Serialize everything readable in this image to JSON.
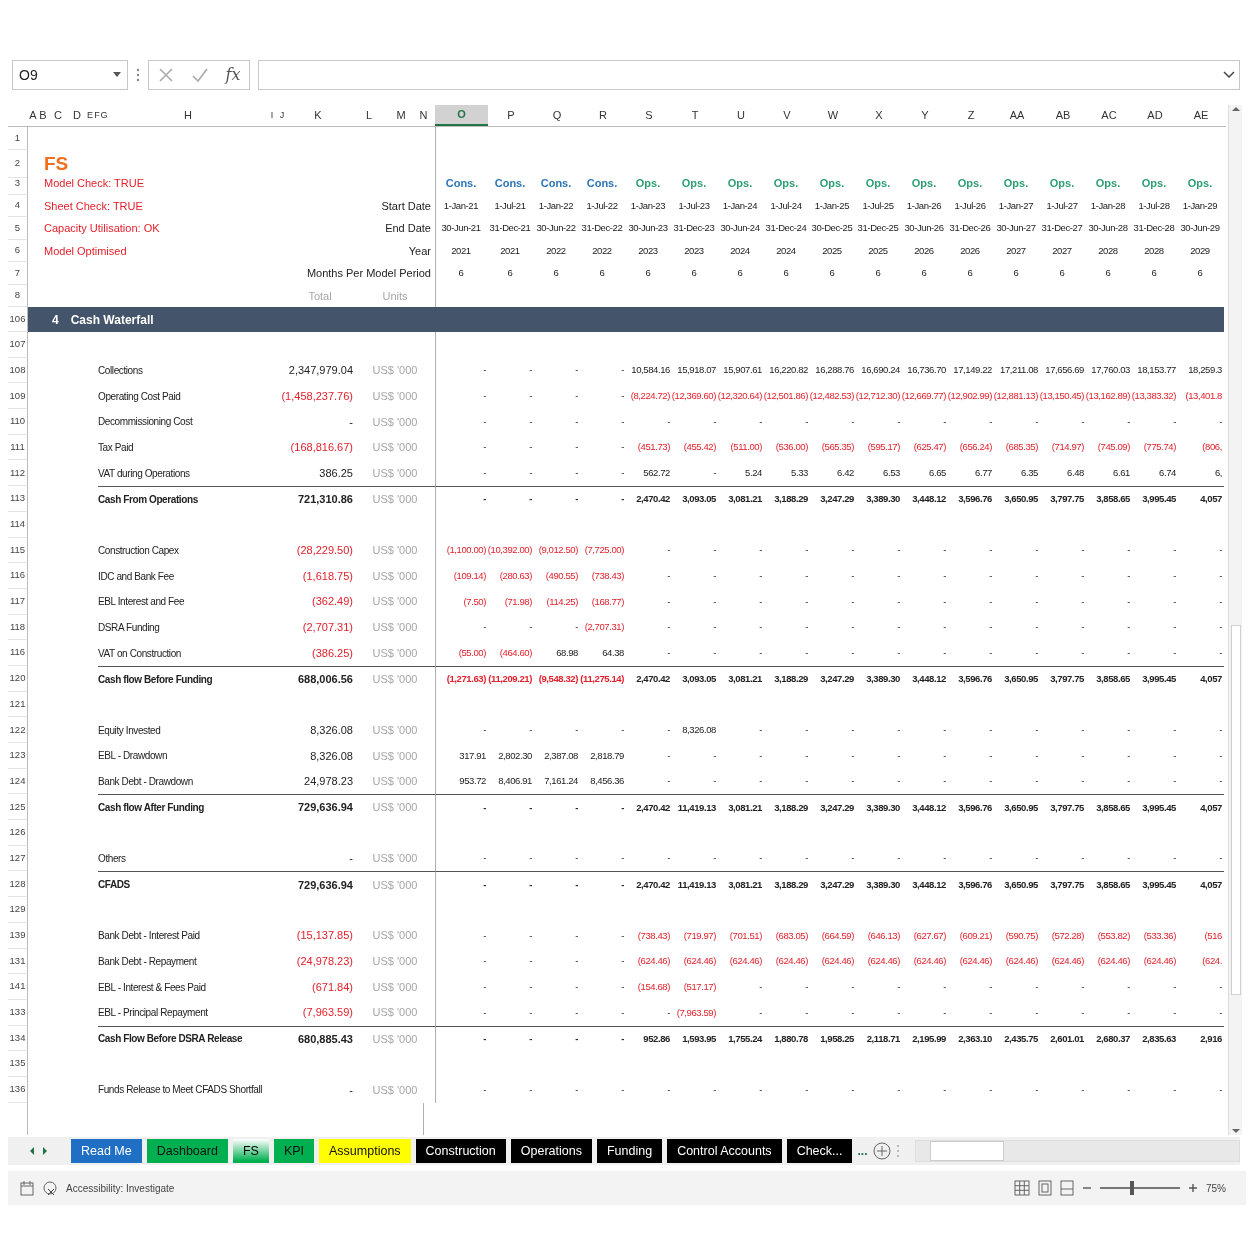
{
  "formula_bar": {
    "name_box": "O9",
    "function_label": "fx"
  },
  "columns": [
    {
      "label": "A",
      "selected": false
    },
    {
      "label": "B",
      "selected": false
    },
    {
      "label": "C",
      "selected": false
    },
    {
      "label": "D",
      "selected": false
    },
    {
      "label": "E",
      "selected": false
    },
    {
      "label": "F",
      "selected": false
    },
    {
      "label": "G",
      "selected": false
    },
    {
      "label": "H",
      "selected": false
    },
    {
      "label": "I",
      "selected": false
    },
    {
      "label": "J",
      "selected": false
    },
    {
      "label": "K",
      "selected": false
    },
    {
      "label": "L",
      "selected": false
    },
    {
      "label": "M",
      "selected": false
    },
    {
      "label": "N",
      "selected": false
    },
    {
      "label": "O",
      "selected": true
    },
    {
      "label": "P",
      "selected": false
    },
    {
      "label": "Q",
      "selected": false
    },
    {
      "label": "R",
      "selected": false
    },
    {
      "label": "S",
      "selected": false
    },
    {
      "label": "T",
      "selected": false
    },
    {
      "label": "U",
      "selected": false
    },
    {
      "label": "V",
      "selected": false
    },
    {
      "label": "W",
      "selected": false
    },
    {
      "label": "X",
      "selected": false
    },
    {
      "label": "Y",
      "selected": false
    },
    {
      "label": "Z",
      "selected": false
    },
    {
      "label": "AA",
      "selected": false
    },
    {
      "label": "AB",
      "selected": false
    },
    {
      "label": "AC",
      "selected": false
    },
    {
      "label": "AD",
      "selected": false
    },
    {
      "label": "AE",
      "selected": false
    }
  ],
  "rows": [
    {
      "row": "1",
      "kind": "blank"
    },
    {
      "row": "2",
      "kind": "title",
      "text": "FS"
    },
    {
      "row": "3",
      "kind": "phase",
      "status": "Model Check: TRUE",
      "cells": [
        {
          "text": "Cons.",
          "color": "#2e75b6"
        },
        {
          "text": "Cons.",
          "color": "#2e75b6"
        },
        {
          "text": "Cons.",
          "color": "#2e75b6"
        },
        {
          "text": "Cons.",
          "color": "#2e75b6"
        },
        {
          "text": "Ops.",
          "color": "#2e9e74"
        },
        {
          "text": "Ops.",
          "color": "#2e9e74"
        },
        {
          "text": "Ops.",
          "color": "#2e9e74"
        },
        {
          "text": "Ops.",
          "color": "#2e9e74"
        },
        {
          "text": "Ops.",
          "color": "#2e9e74"
        },
        {
          "text": "Ops.",
          "color": "#2e9e74"
        },
        {
          "text": "Ops.",
          "color": "#2e9e74"
        },
        {
          "text": "Ops.",
          "color": "#2e9e74"
        },
        {
          "text": "Ops.",
          "color": "#2e9e74"
        },
        {
          "text": "Ops.",
          "color": "#2e9e74"
        },
        {
          "text": "Ops.",
          "color": "#2e9e74"
        },
        {
          "text": "Ops.",
          "color": "#2e9e74"
        },
        {
          "text": "Ops.",
          "color": "#2e9e74"
        }
      ]
    },
    {
      "row": "4",
      "kind": "header",
      "status": "Sheet Check: TRUE",
      "label": "Start Date",
      "cells": [
        "1-Jan-21",
        "1-Jul-21",
        "1-Jan-22",
        "1-Jul-22",
        "1-Jan-23",
        "1-Jul-23",
        "1-Jan-24",
        "1-Jul-24",
        "1-Jan-25",
        "1-Jul-25",
        "1-Jan-26",
        "1-Jul-26",
        "1-Jan-27",
        "1-Jul-27",
        "1-Jan-28",
        "1-Jul-28",
        "1-Jan-29"
      ]
    },
    {
      "row": "5",
      "kind": "header",
      "status": "Capacity Utilisation: OK",
      "label": "End Date",
      "cells": [
        "30-Jun-21",
        "31-Dec-21",
        "30-Jun-22",
        "31-Dec-22",
        "30-Jun-23",
        "31-Dec-23",
        "30-Jun-24",
        "31-Dec-24",
        "30-Dec-25",
        "31-Dec-25",
        "30-Jun-26",
        "31-Dec-26",
        "30-Jun-27",
        "31-Dec-27",
        "30-Jun-28",
        "31-Dec-28",
        "30-Jun-29"
      ]
    },
    {
      "row": "6",
      "kind": "header",
      "status": "Model Optimised",
      "label": "Year",
      "cells": [
        "2021",
        "2021",
        "2022",
        "2022",
        "2023",
        "2023",
        "2024",
        "2024",
        "2025",
        "2025",
        "2026",
        "2026",
        "2027",
        "2027",
        "2028",
        "2028",
        "2029"
      ]
    },
    {
      "row": "7",
      "kind": "header",
      "label": "Months Per Model Period",
      "cells": [
        "6",
        "6",
        "6",
        "6",
        "6",
        "6",
        "6",
        "6",
        "6",
        "6",
        "6",
        "6",
        "6",
        "6",
        "6",
        "6",
        "6"
      ]
    },
    {
      "row": "8",
      "kind": "units_header",
      "total": "Total",
      "units": "Units"
    },
    {
      "row": "106",
      "kind": "section",
      "number": "4",
      "label": "Cash Waterfall"
    },
    {
      "row": "107",
      "kind": "blank"
    },
    {
      "row": "108",
      "kind": "item",
      "label": "Collections",
      "total": "2,347,979.04",
      "units": "US$ '000",
      "cells": [
        "-",
        "-",
        "-",
        "-",
        "10,584.16",
        "15,918.07",
        "15,907.61",
        "16,220.82",
        "16,288.76",
        "16,690.24",
        "16,736.70",
        "17,149.22",
        "17,211.08",
        "17,656.69",
        "17,760.03",
        "18,153.77",
        "18,259.3"
      ]
    },
    {
      "row": "109",
      "kind": "item",
      "label": "Operating Cost Paid",
      "total": "(1,458,237.76)",
      "units": "US$ '000",
      "cells": [
        "-",
        "-",
        "-",
        "-",
        "(8,224.72)",
        "(12,369.60)",
        "(12,320.64)",
        "(12,501.86)",
        "(12,482.53)",
        "(12,712.30)",
        "(12,669.77)",
        "(12,902.99)",
        "(12,881.13)",
        "(13,150.45)",
        "(13,162.89)",
        "(13,383.32)",
        "(13,401.8"
      ]
    },
    {
      "row": "110",
      "kind": "item",
      "label": "Decommissioning Cost",
      "total": "-",
      "units": "US$ '000",
      "cells": [
        "-",
        "-",
        "-",
        "-",
        "-",
        "-",
        "-",
        "-",
        "-",
        "-",
        "-",
        "-",
        "-",
        "-",
        "-",
        "-",
        "-"
      ]
    },
    {
      "row": "111",
      "kind": "item",
      "label": "Tax Paid",
      "total": "(168,816.67)",
      "units": "US$ '000",
      "cells": [
        "-",
        "-",
        "-",
        "-",
        "(451.73)",
        "(455.42)",
        "(511.00)",
        "(536.00)",
        "(565.35)",
        "(595.17)",
        "(625.47)",
        "(656.24)",
        "(685.35)",
        "(714.97)",
        "(745.09)",
        "(775.74)",
        "(806,"
      ]
    },
    {
      "row": "112",
      "kind": "item",
      "label": "VAT during Operations",
      "total": "386.25",
      "units": "US$ '000",
      "cells": [
        "-",
        "-",
        "-",
        "-",
        "562.72",
        "-",
        "5.24",
        "5.33",
        "6.42",
        "6.53",
        "6.65",
        "6.77",
        "6.35",
        "6.48",
        "6.61",
        "6.74",
        "6,"
      ]
    },
    {
      "row": "113",
      "kind": "total",
      "label": "Cash From Operations",
      "total": "721,310.86",
      "units": "US$ '000",
      "cells": [
        "-",
        "-",
        "-",
        "-",
        "2,470.42",
        "3,093.05",
        "3,081.21",
        "3,188.29",
        "3,247.29",
        "3,389.30",
        "3,448.12",
        "3,596.76",
        "3,650.95",
        "3,797.75",
        "3,858.65",
        "3,995.45",
        "4,057"
      ]
    },
    {
      "row": "114",
      "kind": "blank"
    },
    {
      "row": "115",
      "kind": "item",
      "label": "Construction Capex",
      "total": "(28,229.50)",
      "units": "US$ '000",
      "cells": [
        "(1,100.00)",
        "(10,392.00)",
        "(9,012.50)",
        "(7,725.00)",
        "-",
        "-",
        "-",
        "-",
        "-",
        "-",
        "-",
        "-",
        "-",
        "-",
        "-",
        "-",
        "-"
      ]
    },
    {
      "row": "116",
      "kind": "item",
      "label": "IDC and Bank Fee",
      "total": "(1,618.75)",
      "units": "US$ '000",
      "cells": [
        "(109.14)",
        "(280.63)",
        "(490.55)",
        "(738.43)",
        "-",
        "-",
        "-",
        "-",
        "-",
        "-",
        "-",
        "-",
        "-",
        "-",
        "-",
        "-",
        "-"
      ]
    },
    {
      "row": "117",
      "kind": "item",
      "label": "EBL Interest and Fee",
      "total": "(362.49)",
      "units": "US$ '000",
      "cells": [
        "(7.50)",
        "(71.98)",
        "(114.25)",
        "(168.77)",
        "-",
        "-",
        "-",
        "-",
        "-",
        "-",
        "-",
        "-",
        "-",
        "-",
        "-",
        "-",
        "-"
      ]
    },
    {
      "row": "118",
      "kind": "item",
      "label": "DSRA Funding",
      "total": "(2,707.31)",
      "units": "US$ '000",
      "cells": [
        "-",
        "-",
        "-",
        "(2,707.31)",
        "-",
        "-",
        "-",
        "-",
        "-",
        "-",
        "-",
        "-",
        "-",
        "-",
        "-",
        "-",
        "-"
      ]
    },
    {
      "row": "116",
      "kind": "item",
      "label": "VAT on Construction",
      "total": "(386.25)",
      "units": "US$ '000",
      "cells": [
        "(55.00)",
        "(464.60)",
        "68.98",
        "64.38",
        "-",
        "-",
        "-",
        "-",
        "-",
        "-",
        "-",
        "-",
        "-",
        "-",
        "-",
        "-",
        "-"
      ]
    },
    {
      "row": "120",
      "kind": "total",
      "label": "Cash flow Before Funding",
      "total": "688,006.56",
      "units": "US$ '000",
      "cells": [
        "(1,271.63)",
        "(11,209.21)",
        "(9,548.32)",
        "(11,275.14)",
        "2,470.42",
        "3,093.05",
        "3,081.21",
        "3,188.29",
        "3,247.29",
        "3,389.30",
        "3,448.12",
        "3,596.76",
        "3,650.95",
        "3,797.75",
        "3,858.65",
        "3,995.45",
        "4,057"
      ]
    },
    {
      "row": "121",
      "kind": "blank"
    },
    {
      "row": "122",
      "kind": "item",
      "label": "Equity Invested",
      "total": "8,326.08",
      "units": "US$ '000",
      "cells": [
        "-",
        "-",
        "-",
        "-",
        "-",
        "8,326.08",
        "-",
        "-",
        "-",
        "-",
        "-",
        "-",
        "-",
        "-",
        "-",
        "-",
        "-"
      ]
    },
    {
      "row": "123",
      "kind": "item",
      "label": "EBL - Drawdown",
      "total": "8,326.08",
      "units": "US$ '000",
      "cells": [
        "317.91",
        "2,802.30",
        "2,387.08",
        "2,818.79",
        "-",
        "-",
        "-",
        "-",
        "-",
        "-",
        "-",
        "-",
        "-",
        "-",
        "-",
        "-",
        "-"
      ]
    },
    {
      "row": "124",
      "kind": "item",
      "label": "Bank Debt - Drawdown",
      "total": "24,978.23",
      "units": "US$ '000",
      "cells": [
        "953.72",
        "8,406.91",
        "7,161.24",
        "8,456.36",
        "-",
        "-",
        "-",
        "-",
        "-",
        "-",
        "-",
        "-",
        "-",
        "-",
        "-",
        "-",
        "-"
      ]
    },
    {
      "row": "125",
      "kind": "total",
      "label": "Cash flow After Funding",
      "total": "729,636.94",
      "units": "US$ '000",
      "cells": [
        "-",
        "-",
        "-",
        "-",
        "2,470.42",
        "11,419.13",
        "3,081.21",
        "3,188.29",
        "3,247.29",
        "3,389.30",
        "3,448.12",
        "3,596.76",
        "3,650.95",
        "3,797.75",
        "3,858.65",
        "3,995.45",
        "4,057"
      ]
    },
    {
      "row": "126",
      "kind": "blank"
    },
    {
      "row": "127",
      "kind": "item",
      "label": "Others",
      "total": "-",
      "units": "US$ '000",
      "cells": [
        "-",
        "-",
        "-",
        "-",
        "-",
        "-",
        "-",
        "-",
        "-",
        "-",
        "-",
        "-",
        "-",
        "-",
        "-",
        "-",
        "-"
      ]
    },
    {
      "row": "128",
      "kind": "total",
      "label": "CFADS",
      "total": "729,636.94",
      "units": "US$ '000",
      "cells": [
        "-",
        "-",
        "-",
        "-",
        "2,470.42",
        "11,419.13",
        "3,081.21",
        "3,188.29",
        "3,247.29",
        "3,389.30",
        "3,448.12",
        "3,596.76",
        "3,650.95",
        "3,797.75",
        "3,858.65",
        "3,995.45",
        "4,057"
      ]
    },
    {
      "row": "129",
      "kind": "blank"
    },
    {
      "row": "139",
      "kind": "item",
      "label": "Bank Debt - Interest Paid",
      "total": "(15,137.85)",
      "units": "US$ '000",
      "cells": [
        "-",
        "-",
        "-",
        "-",
        "(738.43)",
        "(719.97)",
        "(701.51)",
        "(683.05)",
        "(664.59)",
        "(646.13)",
        "(627.67)",
        "(609.21)",
        "(590.75)",
        "(572.28)",
        "(553.82)",
        "(533.36)",
        "(516"
      ]
    },
    {
      "row": "131",
      "kind": "item",
      "label": "Bank Debt - Repayment",
      "total": "(24,978.23)",
      "units": "US$ '000",
      "cells": [
        "-",
        "-",
        "-",
        "-",
        "(624.46)",
        "(624.46)",
        "(624.46)",
        "(624.46)",
        "(624.46)",
        "(624.46)",
        "(624.46)",
        "(624.46)",
        "(624.46)",
        "(624.46)",
        "(624.46)",
        "(624.46)",
        "(624."
      ]
    },
    {
      "row": "141",
      "kind": "item",
      "label": "EBL - Interest & Fees Paid",
      "total": "(671.84)",
      "units": "US$ '000",
      "cells": [
        "-",
        "-",
        "-",
        "-",
        "(154.68)",
        "(517.17)",
        "-",
        "-",
        "-",
        "-",
        "-",
        "-",
        "-",
        "-",
        "-",
        "-",
        "-"
      ]
    },
    {
      "row": "133",
      "kind": "item",
      "label": "EBL - Principal Repayment",
      "total": "(7,963.59)",
      "units": "US$ '000",
      "cells": [
        "-",
        "-",
        "-",
        "-",
        "-",
        "(7,963.59)",
        "-",
        "-",
        "-",
        "-",
        "-",
        "-",
        "-",
        "-",
        "-",
        "-",
        "-"
      ]
    },
    {
      "row": "134",
      "kind": "total",
      "label": "Cash Flow Before DSRA Release",
      "total": "680,885.43",
      "units": "US$ '000",
      "cells": [
        "-",
        "-",
        "-",
        "-",
        "952.86",
        "1,593.95",
        "1,755.24",
        "1,880.78",
        "1,958.25",
        "2,118.71",
        "2,195.99",
        "2,363.10",
        "2,435.75",
        "2,601.01",
        "2,680.37",
        "2,835.63",
        "2,916"
      ]
    },
    {
      "row": "135",
      "kind": "blank"
    },
    {
      "row": "136",
      "kind": "item",
      "label": "Funds Release to Meet CFADS Shortfall",
      "total": "-",
      "units": "US$ '000",
      "cells": [
        "-",
        "-",
        "-",
        "-",
        "-",
        "-",
        "-",
        "-",
        "-",
        "-",
        "-",
        "-",
        "-",
        "-",
        "-",
        "-",
        "-"
      ]
    }
  ],
  "sheet_tabs": [
    {
      "label": "Read Me",
      "color": "#1f6fc5",
      "selected": false
    },
    {
      "label": "Dashboard",
      "color": "#00b050",
      "selected": false
    },
    {
      "label": "FS",
      "color": "#00b050",
      "selected": true
    },
    {
      "label": "KPI",
      "color": "#00b050",
      "selected": false
    },
    {
      "label": "Assumptions",
      "color": "#ffff00",
      "selected": false
    },
    {
      "label": "Construction",
      "color": "#000000",
      "selected": false
    },
    {
      "label": "Operations",
      "color": "#000000",
      "selected": false
    },
    {
      "label": "Funding",
      "color": "#000000",
      "selected": false
    },
    {
      "label": "Control Accounts",
      "color": "#000000",
      "selected": false
    },
    {
      "label": "Check...",
      "color": "#000000",
      "selected": false
    }
  ],
  "more_tabs": "...",
  "status_bar": {
    "accessibility": "Accessibility: Investigate",
    "zoom": {
      "level": 0.4,
      "reading": "75%"
    }
  }
}
